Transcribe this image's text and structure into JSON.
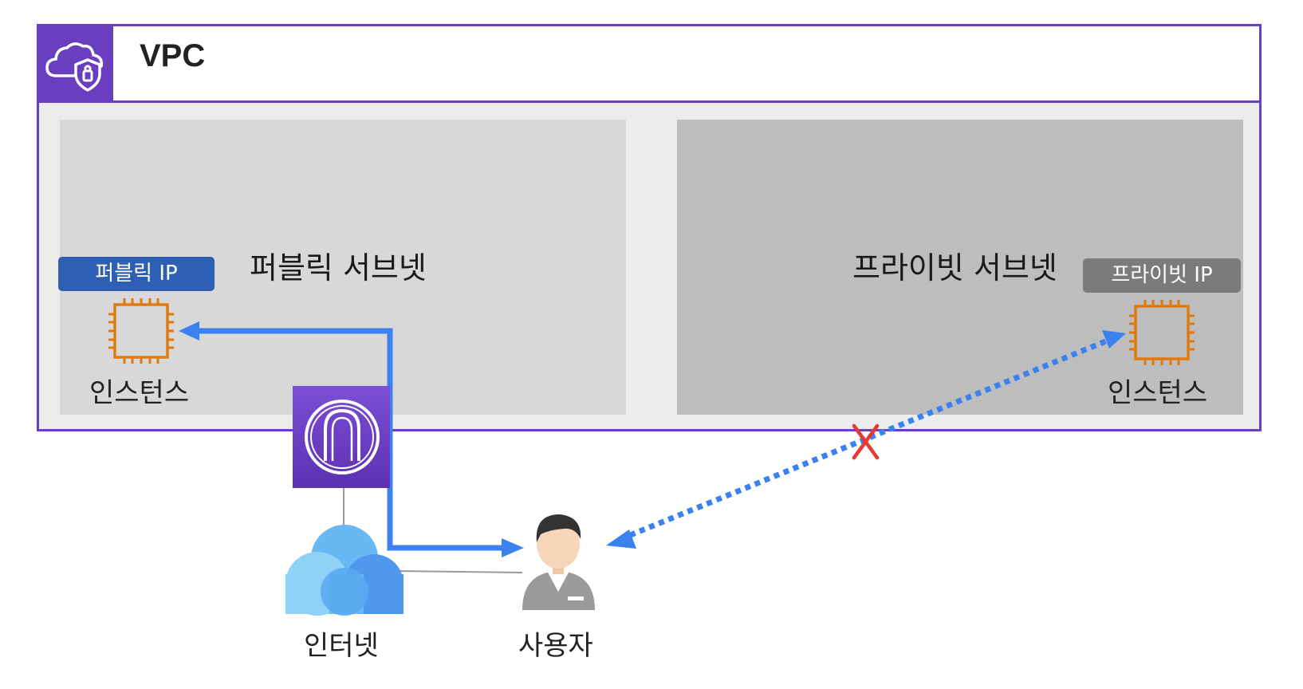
{
  "vpc": {
    "title": "VPC",
    "icon": "vpc-cloud-shield-icon"
  },
  "public_subnet": {
    "label": "퍼블릭 서브넷",
    "ip_badge": "퍼블릭 IP",
    "instance_label": "인스턴스"
  },
  "private_subnet": {
    "label": "프라이빗 서브넷",
    "ip_badge": "프라이빗 IP",
    "instance_label": "인스턴스"
  },
  "gateway": {
    "icon": "internet-gateway-icon"
  },
  "internet": {
    "label": "인터넷",
    "icon": "internet-cloud-icon"
  },
  "user": {
    "label": "사용자",
    "icon": "user-avatar-icon"
  },
  "colors": {
    "vpc_border": "#6a3fbf",
    "public_ip_badge": "#2f5fb4",
    "private_ip_badge": "#7b7b7b",
    "arrow": "#3b82f0",
    "blocked_mark": "#e53935",
    "chip": "#e07a10"
  }
}
